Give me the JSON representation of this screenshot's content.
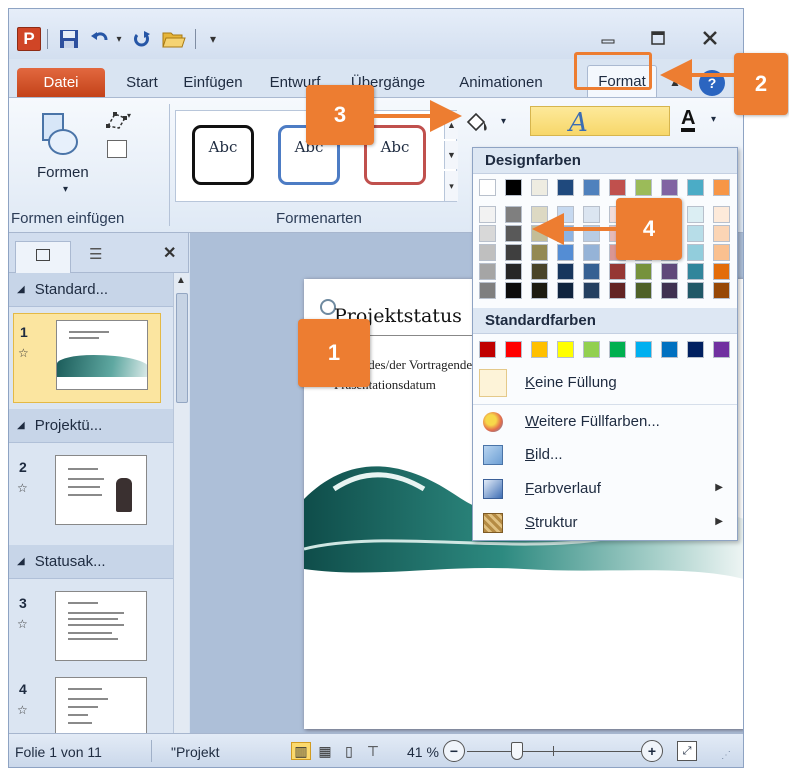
{
  "titlebar": {
    "app_icon_letter": "P",
    "icons": [
      "save-icon",
      "undo-icon",
      "redo-icon",
      "open-folder-icon"
    ],
    "minimize": "▭",
    "maximize": "□",
    "close": "✕"
  },
  "tabs": {
    "file": "Datei",
    "start": "Start",
    "insert": "Einfügen",
    "design": "Entwurf",
    "transitions": "Übergänge",
    "animations": "Animationen",
    "format": "Format"
  },
  "ribbon": {
    "shapes_button": "Formen",
    "group_insert_shapes": "Formen einfügen",
    "group_shape_styles": "Formenarten",
    "style_samples": [
      "Abc",
      "Abc",
      "Abc"
    ]
  },
  "panel": {
    "sections": [
      "Standard...",
      "Projektü...",
      "Statusak..."
    ],
    "slides": [
      {
        "number": "1"
      },
      {
        "number": "2"
      },
      {
        "number": "3"
      },
      {
        "number": "4"
      }
    ]
  },
  "slide": {
    "title": "Projektstatus",
    "presenter": "Name des/der Vortragenden",
    "date": "Präsentationsdatum"
  },
  "dropdown": {
    "design_colors_header": "Designfarben",
    "standard_colors_header": "Standardfarben",
    "theme_top_row": [
      "#FFFFFF",
      "#000000",
      "#EEECE1",
      "#1F497D",
      "#4F81BD",
      "#C0504D",
      "#9BBB59",
      "#8064A2",
      "#4BACC6",
      "#F79646"
    ],
    "theme_shades": [
      [
        "#F2F2F2",
        "#7F7F7F",
        "#DDD9C3",
        "#C6D9F0",
        "#DBE5F1",
        "#F2DCDB",
        "#EBF1DD",
        "#E5E0EC",
        "#DBEEF3",
        "#FDEADA"
      ],
      [
        "#D8D8D8",
        "#595959",
        "#C4BD97",
        "#8DB3E2",
        "#B8CCE4",
        "#E5B9B7",
        "#D7E3BC",
        "#CCC1D9",
        "#B7DDE8",
        "#FBD5B5"
      ],
      [
        "#BFBFBF",
        "#3F3F3F",
        "#938953",
        "#548DD4",
        "#95B3D7",
        "#D99694",
        "#C3D69B",
        "#B2A2C7",
        "#92CDDC",
        "#FAC08F"
      ],
      [
        "#A5A5A5",
        "#262626",
        "#494429",
        "#17365D",
        "#366092",
        "#953734",
        "#76923C",
        "#5F497A",
        "#31859B",
        "#E36C09"
      ],
      [
        "#7F7F7F",
        "#0C0C0C",
        "#1D1B10",
        "#0F243E",
        "#244061",
        "#632423",
        "#4F6128",
        "#3F3151",
        "#205867",
        "#974806"
      ]
    ],
    "standard_colors": [
      "#C00000",
      "#FF0000",
      "#FFC000",
      "#FFFF00",
      "#92D050",
      "#00B050",
      "#00B0F0",
      "#0070C0",
      "#002060",
      "#7030A0"
    ],
    "no_fill": "Keine Füllung",
    "more_colors": "Weitere Füllfarben...",
    "picture": "Bild...",
    "gradient": "Farbverlauf",
    "texture": "Struktur"
  },
  "statusbar": {
    "slide_info": "Folie 1 von 11",
    "theme": "\"Projekt",
    "zoom": "41 %"
  },
  "callouts": {
    "one": "1",
    "two": "2",
    "three": "3",
    "four": "4"
  },
  "colors": {
    "callout": "#ED7D31",
    "file_tab": "#C94A1F",
    "selected_slide": "#FBE5A0"
  }
}
